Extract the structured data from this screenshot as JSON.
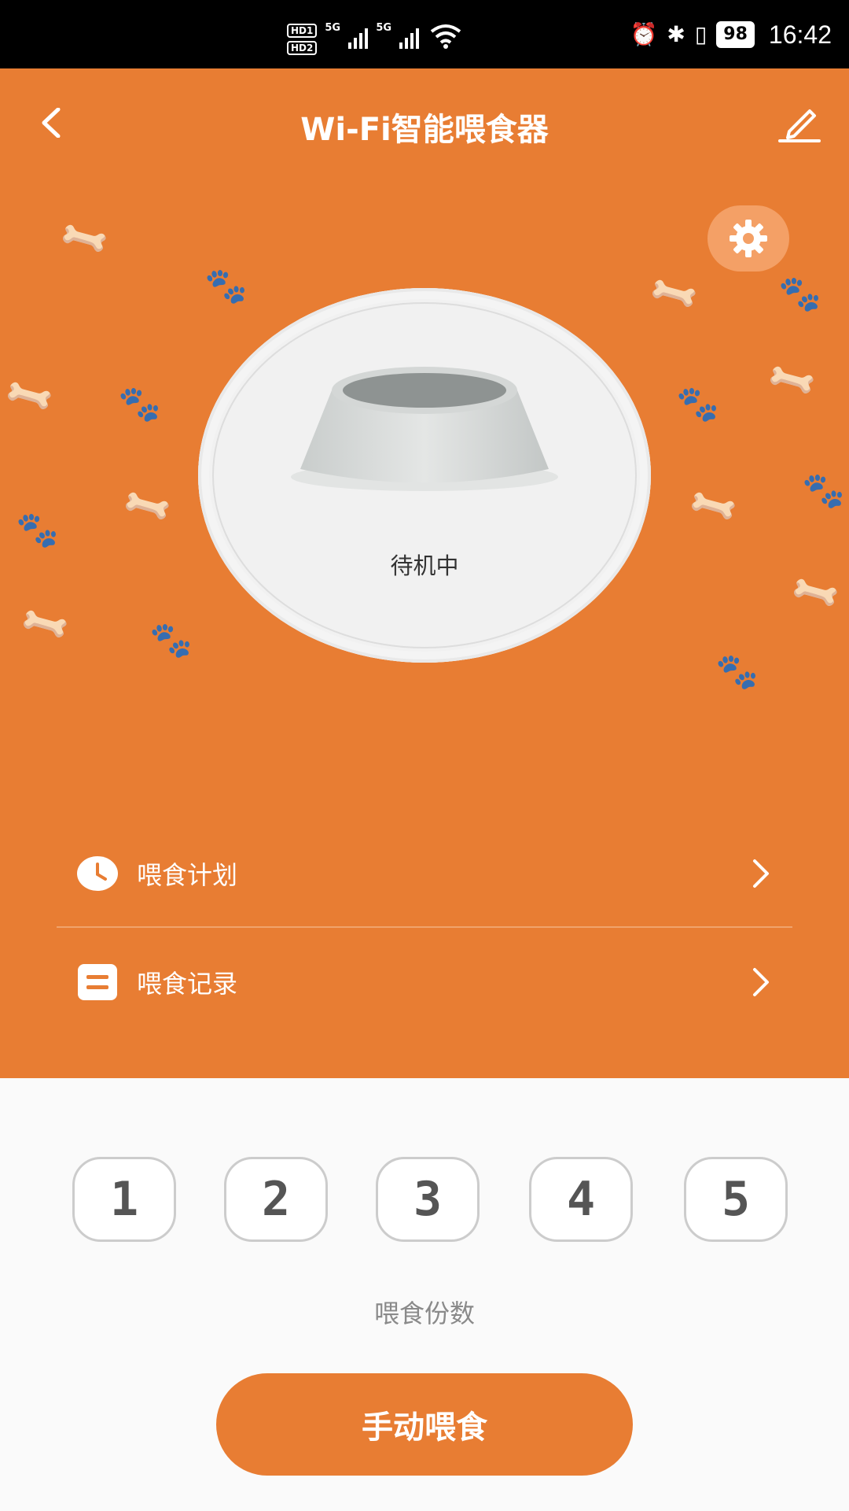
{
  "status_bar": {
    "hd1": "HD1",
    "hd2": "HD2",
    "sim1_type": "5G",
    "sim2_type": "5G",
    "battery": "98",
    "time": "16:42"
  },
  "header": {
    "title": "Wi-Fi智能喂食器"
  },
  "device": {
    "status": "待机中"
  },
  "menu": {
    "items": [
      {
        "label": "喂食计划",
        "icon": "clock-icon"
      },
      {
        "label": "喂食记录",
        "icon": "list-icon"
      }
    ]
  },
  "portions": {
    "options": [
      "1",
      "2",
      "3",
      "4",
      "5"
    ],
    "label": "喂食份数"
  },
  "actions": {
    "manual_feed": "手动喂食"
  },
  "colors": {
    "accent": "#E87D33",
    "background": "#FAFAFA"
  }
}
